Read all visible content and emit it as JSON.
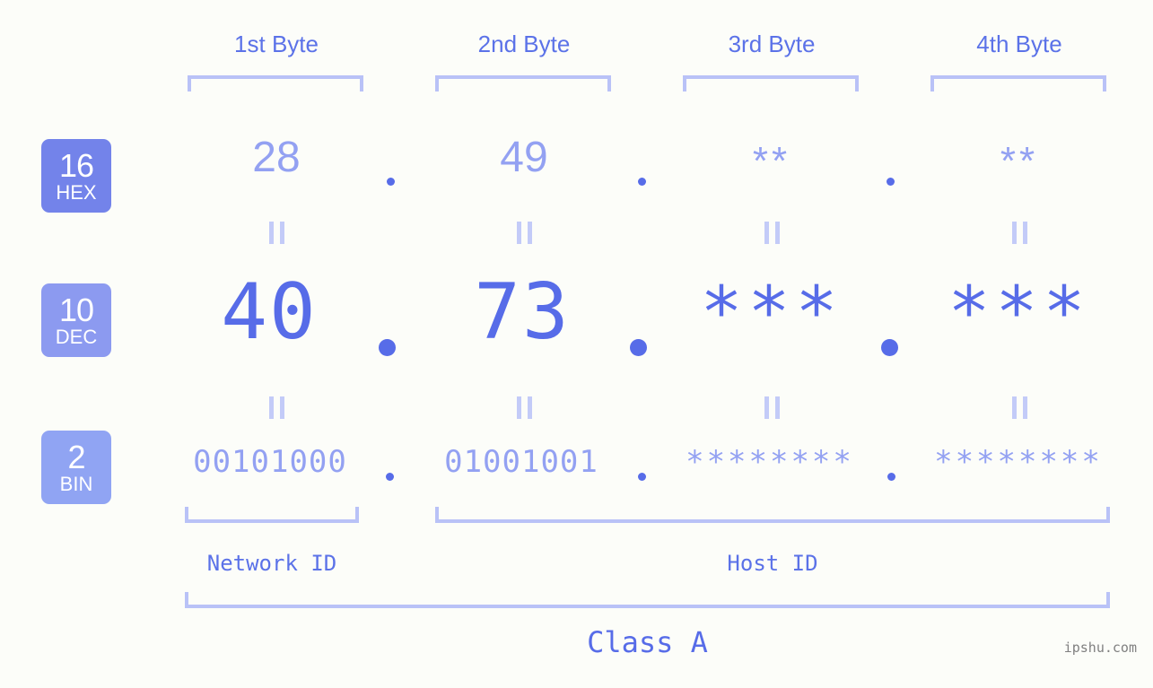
{
  "headers": [
    {
      "label": "1st Byte"
    },
    {
      "label": "2nd Byte"
    },
    {
      "label": "3rd Byte"
    },
    {
      "label": "4th Byte"
    }
  ],
  "bases": [
    {
      "number": "16",
      "abbr": "HEX",
      "color": "#7383ea"
    },
    {
      "number": "10",
      "abbr": "DEC",
      "color": "#8c9af0"
    },
    {
      "number": "2",
      "abbr": "BIN",
      "color": "#90a4f3"
    }
  ],
  "rows": {
    "hex": {
      "values": [
        "28",
        "49",
        "**",
        "**"
      ]
    },
    "dec": {
      "values": [
        "40",
        "73",
        "***",
        "***"
      ]
    },
    "bin": {
      "values": [
        "00101000",
        "01001001",
        "********",
        "********"
      ]
    }
  },
  "separators": {
    "hex": ".",
    "dec": ".",
    "bin": "."
  },
  "equality_mark": "||",
  "segments": {
    "network_id": "Network ID",
    "host_id": "Host ID",
    "class": "Class A"
  },
  "watermark": "ipshu.com",
  "colors": {
    "background": "#fcfdf9",
    "accent_strong": "#576ce8",
    "accent_mid": "#5b72e8",
    "accent_light": "#93a1f2",
    "bracket": "#b9c2f7",
    "eqmark": "#c3cbf8",
    "watermark": "#808080"
  }
}
